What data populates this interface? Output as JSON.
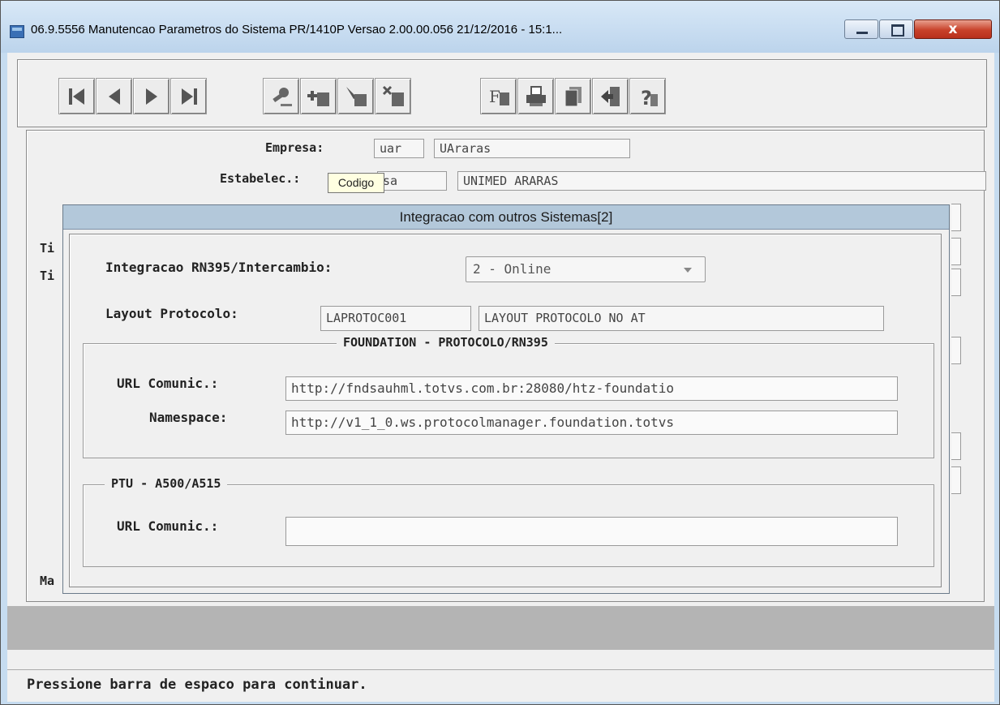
{
  "window": {
    "title": "06.9.5556 Manutencao  Parametros do Sistema PR/1410P Versao 2.00.00.056 21/12/2016 - 15:1...",
    "close_glyph": "x"
  },
  "toolbar": {
    "buttons": [
      {
        "icon": "first-record-icon"
      },
      {
        "icon": "previous-record-icon"
      },
      {
        "icon": "next-record-icon"
      },
      {
        "icon": "last-record-icon"
      },
      {
        "icon": "search-key-icon"
      },
      {
        "icon": "add-record-icon"
      },
      {
        "icon": "edit-record-icon"
      },
      {
        "icon": "delete-record-icon"
      },
      {
        "icon": "filter-icon"
      },
      {
        "icon": "print-icon"
      },
      {
        "icon": "copy-icon"
      },
      {
        "icon": "exit-icon"
      },
      {
        "icon": "help-icon"
      }
    ],
    "tooltip": "Codigo"
  },
  "form": {
    "empresa_label": "Empresa:",
    "empresa_code": "uar",
    "empresa_name": "UAraras",
    "estabelec_label": "Estabelec.:",
    "estabelec_code": "sa",
    "estabelec_name": "UNIMED ARARAS",
    "partial_labels": [
      "Ti",
      "Ti",
      "Ma"
    ]
  },
  "dialog": {
    "title": "Integracao com outros Sistemas[2]",
    "integracao_label": "Integracao RN395/Intercambio:",
    "integracao_value": "2 - Online",
    "layout_label": "Layout Protocolo:",
    "layout_code": "LAPROTOC001",
    "layout_desc": "LAYOUT PROTOCOLO NO AT",
    "foundation": {
      "legend": "FOUNDATION - PROTOCOLO/RN395",
      "url_label": "URL Comunic.:",
      "url_value": "http://fndsauhml.totvs.com.br:28080/htz-foundatio",
      "namespace_label": "Namespace:",
      "namespace_value": "http://v1_1_0.ws.protocolmanager.foundation.totvs"
    },
    "ptu": {
      "legend": "PTU - A500/A515",
      "url_label": "URL Comunic.:",
      "url_value": ""
    }
  },
  "status": {
    "message": "Pressione barra de espaco para continuar."
  }
}
